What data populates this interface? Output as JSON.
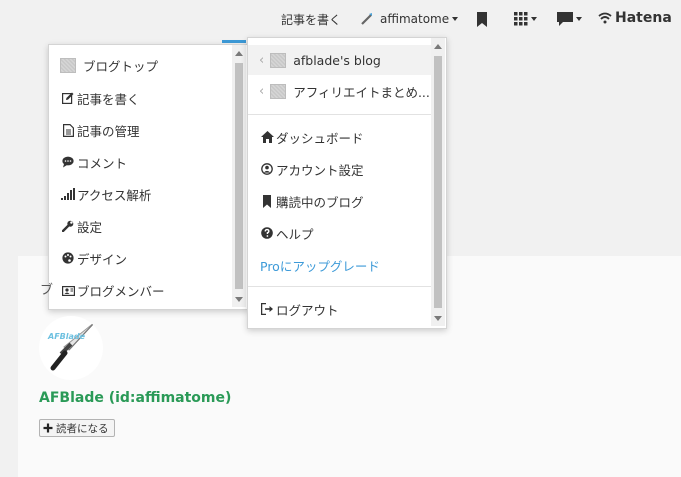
{
  "header": {
    "write_label": "記事を書く",
    "user_name": "affimatome",
    "brand": "Hatena"
  },
  "left_menu": {
    "items": [
      {
        "label": "ブログトップ",
        "icon": "blog-thumbnail"
      },
      {
        "label": "記事を書く",
        "icon": "edit-icon"
      },
      {
        "label": "記事の管理",
        "icon": "document-icon"
      },
      {
        "label": "コメント",
        "icon": "comment-icon"
      },
      {
        "label": "アクセス解析",
        "icon": "signal-bars-icon"
      },
      {
        "label": "設定",
        "icon": "wrench-icon"
      },
      {
        "label": "デザイン",
        "icon": "palette-icon"
      },
      {
        "label": "ブログメンバー",
        "icon": "members-icon"
      }
    ]
  },
  "right_menu": {
    "blogs": [
      {
        "label": "afblade's blog"
      },
      {
        "label": "アフィリエイトまとめ..."
      }
    ],
    "items": [
      {
        "label": "ダッシュボード",
        "icon": "home-icon"
      },
      {
        "label": "アカウント設定",
        "icon": "user-icon"
      },
      {
        "label": "購読中のブログ",
        "icon": "bookmark-icon"
      },
      {
        "label": "ヘルプ",
        "icon": "question-icon"
      }
    ],
    "upgrade_label": "Proにアップグレード",
    "logout_label": "ログアウト",
    "accent_color": "#3d9ad8"
  },
  "profile": {
    "name": "AFBlade (id:affimatome)",
    "follow_label": "読者になる",
    "avatar_text": "AFBlade",
    "name_color": "#2a9a57"
  },
  "partial_text": "ブ"
}
